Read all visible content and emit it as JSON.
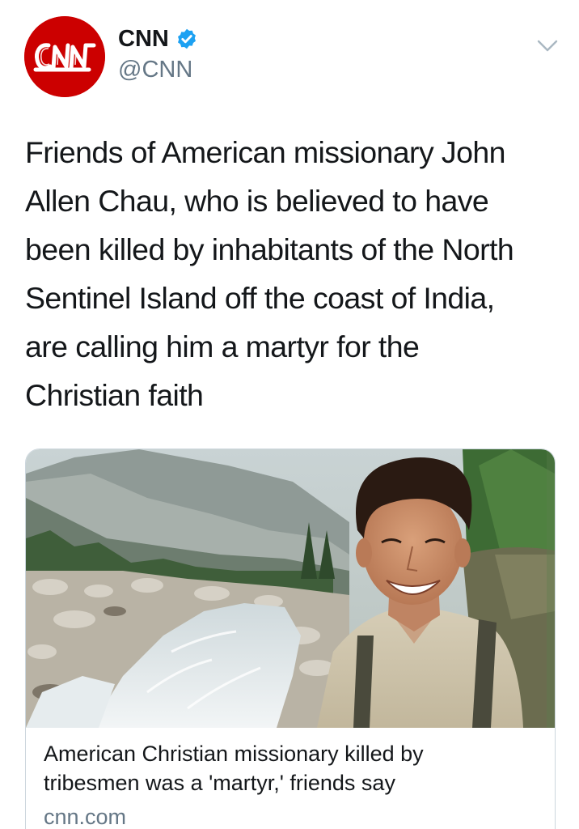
{
  "account": {
    "display_name": "CNN",
    "handle": "@CNN",
    "avatar_logo_text": "CNN",
    "verified": true,
    "brand_color": "#cc0000",
    "verified_color": "#1da1f2"
  },
  "tweet": {
    "text_lines": [
      "Friends of American missionary John",
      "Allen Chau, who is believed to have",
      "been killed by inhabitants of the North",
      "Sentinel Island off the coast of India,",
      "are calling him a martyr for the",
      "Christian faith"
    ]
  },
  "card": {
    "title_lines": [
      "American Christian missionary killed by",
      "tribesmen was a 'martyr,' friends say"
    ],
    "domain": "cnn.com",
    "image_description_icon": "photo-man-mountain-river"
  },
  "icons": {
    "menu": "chevron-down-icon",
    "verified": "verified-badge-icon"
  }
}
